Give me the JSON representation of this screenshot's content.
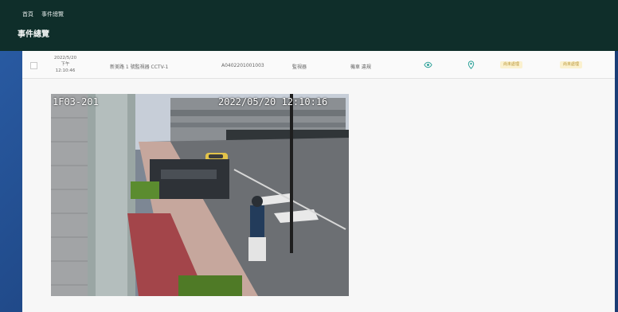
{
  "header": {
    "links": [
      "首頁",
      "事件總覽"
    ],
    "title": "事件總覽"
  },
  "event_row": {
    "date": "2022/5/20",
    "period": "下午",
    "time": "12:10:46",
    "location": "新美路 1 號監視器 CCTV-1",
    "event_id": "A0402201001003",
    "type": "監視器",
    "detail": "機車 違規",
    "badge_1": "尚未處理",
    "badge_2": "尚未處理"
  },
  "camera": {
    "id": "1F03-201",
    "timestamp": "2022/05/20 12:10:16"
  },
  "colors": {
    "topbar": "#0f2e2a",
    "accent": "#2fa39a",
    "badge_bg": "#fbf1cf"
  }
}
